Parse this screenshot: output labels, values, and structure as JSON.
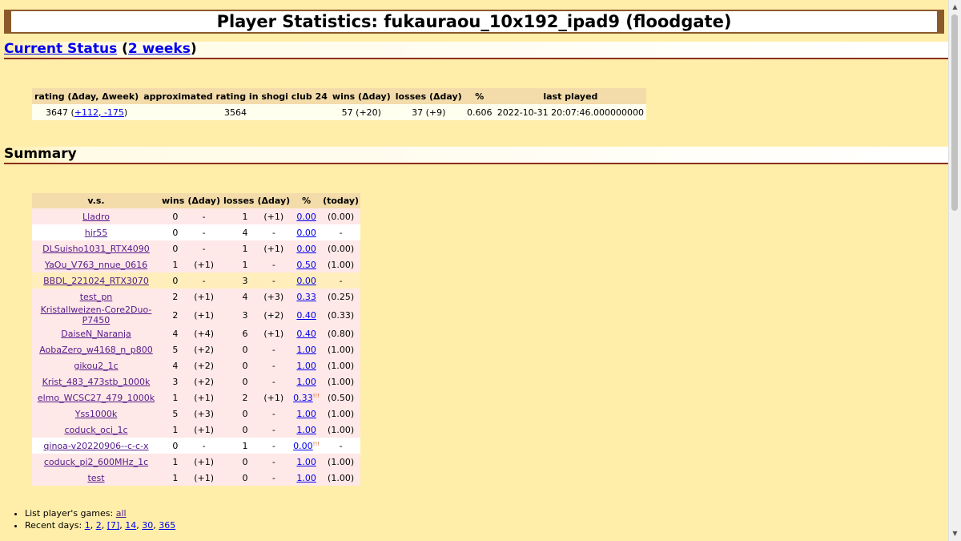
{
  "page_title": "Player Statistics: fukauraou_10x192_ipad9 (floodgate)",
  "current_status": {
    "link1": "Current Status",
    "open": " (",
    "link2": "2 weeks",
    "close": ")"
  },
  "status_table": {
    "headers": [
      "rating (Δday, Δweek)",
      "approximated rating in shogi club 24",
      "wins (Δday)",
      "losses (Δday)",
      "%",
      "last played"
    ],
    "rating": "3647",
    "rating_delta": "+112, -175",
    "approx_rating": "3564",
    "wins": "57 (+20)",
    "losses": "37 (+9)",
    "pct": "0.606",
    "last_played": "2022-10-31 20:07:46.000000000"
  },
  "summary_heading": "Summary",
  "summary_table": {
    "headers": [
      "v.s.",
      "wins",
      "(Δday)",
      "losses",
      "(Δday)",
      "%",
      "(today)"
    ],
    "rows": [
      {
        "opponent": "Lladro",
        "wins": "0",
        "wd": "-",
        "losses": "1",
        "ld": "(+1)",
        "pct": "0.00",
        "note": "",
        "today": "(0.00)",
        "style": "pink"
      },
      {
        "opponent": "hjr55",
        "wins": "0",
        "wd": "-",
        "losses": "4",
        "ld": "-",
        "pct": "0.00",
        "note": "",
        "today": "-",
        "style": "white"
      },
      {
        "opponent": "DLSuisho1031_RTX4090",
        "wins": "0",
        "wd": "-",
        "losses": "1",
        "ld": "(+1)",
        "pct": "0.00",
        "note": "",
        "today": "(0.00)",
        "style": "pink"
      },
      {
        "opponent": "YaOu_V763_nnue_0616",
        "wins": "1",
        "wd": "(+1)",
        "losses": "1",
        "ld": "-",
        "pct": "0.50",
        "note": "",
        "today": "(1.00)",
        "style": "pink"
      },
      {
        "opponent": "BBDL_221024_RTX3070",
        "wins": "0",
        "wd": "-",
        "losses": "3",
        "ld": "-",
        "pct": "0.00",
        "note": "",
        "today": "-",
        "style": "tan"
      },
      {
        "opponent": "test_pn",
        "wins": "2",
        "wd": "(+1)",
        "losses": "4",
        "ld": "(+3)",
        "pct": "0.33",
        "note": "",
        "today": "(0.25)",
        "style": "pink"
      },
      {
        "opponent": "Kristallweizen-Core2Duo-P7450",
        "wins": "2",
        "wd": "(+1)",
        "losses": "3",
        "ld": "(+2)",
        "pct": "0.40",
        "note": "",
        "today": "(0.33)",
        "style": "pink"
      },
      {
        "opponent": "DaiseN_Naranja",
        "wins": "4",
        "wd": "(+4)",
        "losses": "6",
        "ld": "(+1)",
        "pct": "0.40",
        "note": "",
        "today": "(0.80)",
        "style": "pink"
      },
      {
        "opponent": "AobaZero_w4168_n_p800",
        "wins": "5",
        "wd": "(+2)",
        "losses": "0",
        "ld": "-",
        "pct": "1.00",
        "note": "",
        "today": "(1.00)",
        "style": "pink"
      },
      {
        "opponent": "gikou2_1c",
        "wins": "4",
        "wd": "(+2)",
        "losses": "0",
        "ld": "-",
        "pct": "1.00",
        "note": "",
        "today": "(1.00)",
        "style": "pink"
      },
      {
        "opponent": "Krist_483_473stb_1000k",
        "wins": "3",
        "wd": "(+2)",
        "losses": "0",
        "ld": "-",
        "pct": "1.00",
        "note": "",
        "today": "(1.00)",
        "style": "pink"
      },
      {
        "opponent": "elmo_WCSC27_479_1000k",
        "wins": "1",
        "wd": "(+1)",
        "losses": "2",
        "ld": "(+1)",
        "pct": "0.33",
        "note": "!!!",
        "today": "(0.50)",
        "style": "pink"
      },
      {
        "opponent": "Yss1000k",
        "wins": "5",
        "wd": "(+3)",
        "losses": "0",
        "ld": "-",
        "pct": "1.00",
        "note": "",
        "today": "(1.00)",
        "style": "pink"
      },
      {
        "opponent": "coduck_oci_1c",
        "wins": "1",
        "wd": "(+1)",
        "losses": "0",
        "ld": "-",
        "pct": "1.00",
        "note": "",
        "today": "(1.00)",
        "style": "pink"
      },
      {
        "opponent": "qinoa-v20220906--c-c-x",
        "wins": "0",
        "wd": "-",
        "losses": "1",
        "ld": "-",
        "pct": "0.00",
        "note": "!!!",
        "today": "-",
        "style": "white"
      },
      {
        "opponent": "coduck_pi2_600MHz_1c",
        "wins": "1",
        "wd": "(+1)",
        "losses": "0",
        "ld": "-",
        "pct": "1.00",
        "note": "",
        "today": "(1.00)",
        "style": "pink"
      },
      {
        "opponent": "test",
        "wins": "1",
        "wd": "(+1)",
        "losses": "0",
        "ld": "-",
        "pct": "1.00",
        "note": "",
        "today": "(1.00)",
        "style": "pink"
      }
    ]
  },
  "games_list": {
    "label": "List player's games: ",
    "all_link": "all"
  },
  "recent_days": {
    "label": "Recent days: ",
    "days": [
      "1",
      "2",
      "[7]",
      "14",
      "30",
      "365"
    ]
  }
}
